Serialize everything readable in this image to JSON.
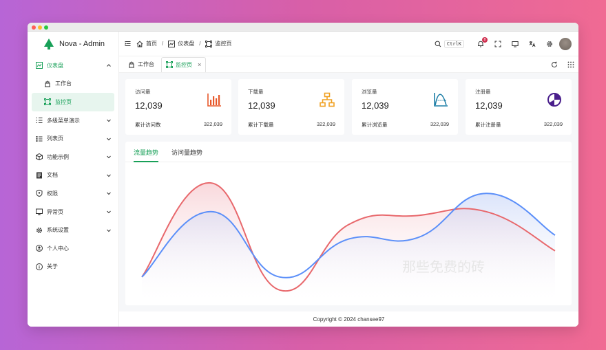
{
  "app": {
    "title": "Nova - Admin",
    "brand_color": "#18a058"
  },
  "sidebar": {
    "items": [
      {
        "label": "仪表盘",
        "icon": "dashboard-icon",
        "expanded": true
      },
      {
        "label": "工作台",
        "icon": "workbench-icon"
      },
      {
        "label": "监控页",
        "icon": "monitor-icon",
        "active": true
      },
      {
        "label": "多级菜单演示",
        "icon": "multi-menu-icon"
      },
      {
        "label": "列表页",
        "icon": "list-icon"
      },
      {
        "label": "功能示例",
        "icon": "cube-icon"
      },
      {
        "label": "文档",
        "icon": "doc-icon"
      },
      {
        "label": "权限",
        "icon": "shield-icon"
      },
      {
        "label": "异常页",
        "icon": "error-page-icon"
      },
      {
        "label": "系统设置",
        "icon": "gear-icon"
      },
      {
        "label": "个人中心",
        "icon": "user-icon"
      },
      {
        "label": "关于",
        "icon": "info-icon"
      }
    ]
  },
  "header": {
    "breadcrumb": [
      "首页",
      "仪表盘",
      "监控页"
    ],
    "search_shortcut": "CtrlK",
    "notification_count": "8"
  },
  "tabs": [
    {
      "label": "工作台",
      "icon": "workbench-icon"
    },
    {
      "label": "监控页",
      "icon": "monitor-icon",
      "active": true
    }
  ],
  "cards": [
    {
      "title": "访问量",
      "value": "12,039",
      "foot_label": "累计访问数",
      "total": "322,039",
      "icon": "bar-chart-icon",
      "color": "#e8582a"
    },
    {
      "title": "下载量",
      "value": "12,039",
      "foot_label": "累计下载量",
      "total": "322,039",
      "icon": "tree-icon",
      "color": "#f0a020"
    },
    {
      "title": "浏览量",
      "value": "12,039",
      "foot_label": "累计浏览量",
      "total": "322,039",
      "icon": "curve-icon",
      "color": "#1d7ea6"
    },
    {
      "title": "注册量",
      "value": "12,039",
      "foot_label": "累计注册量",
      "total": "322,039",
      "icon": "pie-icon",
      "color": "#4a1f8c"
    }
  ],
  "chart_tabs": [
    "流量趋势",
    "访问量趋势"
  ],
  "chart_data": {
    "type": "area",
    "x": [
      0,
      1,
      2,
      3,
      4,
      5,
      6
    ],
    "ylim": [
      0,
      100
    ],
    "series": [
      {
        "values": [
          18,
          90,
          8,
          58,
          65,
          68,
          38
        ],
        "color": "#e8686c"
      },
      {
        "values": [
          18,
          68,
          18,
          47,
          48,
          82,
          50
        ],
        "color": "#5b8ff9"
      }
    ],
    "grid": false
  },
  "footer": {
    "copyright": "Copyright © 2024 chansee97"
  },
  "watermark": "那些免费的砖"
}
